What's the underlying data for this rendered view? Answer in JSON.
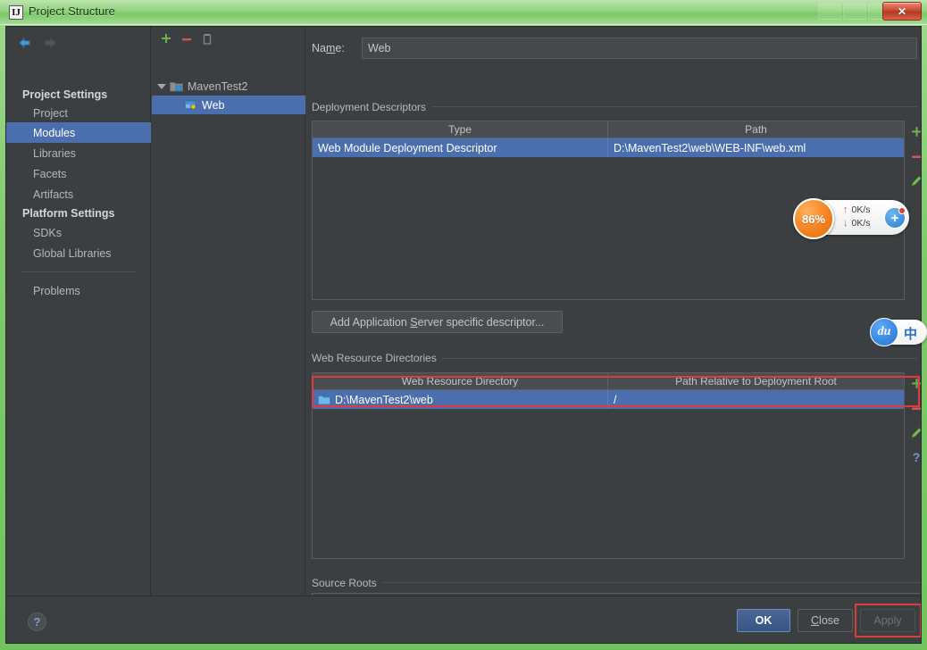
{
  "window": {
    "title": "Project Structure",
    "app_icon": "intellij-idea-icon",
    "close_label": "✕",
    "title_color": "#7fc96c"
  },
  "sidebar": {
    "nav": {
      "back_icon": "back-arrow-icon",
      "forward_icon": "forward-arrow-icon"
    },
    "groups": [
      {
        "label": "Project Settings",
        "items": [
          {
            "label": "Project",
            "selected": false
          },
          {
            "label": "Modules",
            "selected": true
          },
          {
            "label": "Libraries",
            "selected": false
          },
          {
            "label": "Facets",
            "selected": false
          },
          {
            "label": "Artifacts",
            "selected": false
          }
        ]
      },
      {
        "label": "Platform Settings",
        "items": [
          {
            "label": "SDKs",
            "selected": false
          },
          {
            "label": "Global Libraries",
            "selected": false
          }
        ]
      }
    ],
    "extra_item": {
      "label": "Problems",
      "selected": false
    },
    "selected_color": "#4b6eaf"
  },
  "tree": {
    "toolbar": [
      {
        "name": "add-module-button",
        "glyph": "+",
        "color": "#6ab04c"
      },
      {
        "name": "remove-module-button",
        "glyph": "−",
        "color": "#cc5555"
      },
      {
        "name": "copy-module-button",
        "glyph": "⧉",
        "color": "#8a8a8a"
      }
    ],
    "nodes": [
      {
        "label": "MavenTest2",
        "depth": 0,
        "expanded": true,
        "selected": false,
        "icon": "module-icon"
      },
      {
        "label": "Web",
        "depth": 1,
        "expanded": false,
        "selected": true,
        "icon": "web-facet-icon"
      }
    ]
  },
  "detail": {
    "name_field": {
      "label_pre": "Na",
      "label_mnemonic": "m",
      "label_post": "e:",
      "value": "Web",
      "placeholder": ""
    },
    "deployment_descriptors": {
      "title": "Deployment Descriptors",
      "columns": [
        "Type",
        "Path"
      ],
      "rows": [
        {
          "type": "Web Module Deployment Descriptor",
          "path": "D:\\MavenTest2\\web\\WEB-INF\\web.xml",
          "selected": true
        }
      ],
      "tools": [
        {
          "name": "add-descriptor-button",
          "glyph": "+",
          "color": "#6ab04c"
        },
        {
          "name": "remove-descriptor-button",
          "glyph": "−",
          "color": "#cc5555"
        },
        {
          "name": "edit-descriptor-button",
          "glyph": "✎",
          "color": "#7cc24f"
        }
      ]
    },
    "add_descriptor_button": {
      "pre": "Add Application ",
      "mnemonic": "S",
      "post": "erver specific descriptor..."
    },
    "web_resource_directories": {
      "title": "Web Resource Directories",
      "columns": [
        "Web Resource Directory",
        "Path Relative to Deployment Root"
      ],
      "rows": [
        {
          "directory": "D:\\MavenTest2\\web",
          "relative": "/",
          "selected": true
        }
      ],
      "tools": [
        {
          "name": "add-web-resource-button",
          "glyph": "+",
          "color": "#6ab04c"
        },
        {
          "name": "remove-web-resource-button",
          "glyph": "−",
          "color": "#cc5555"
        },
        {
          "name": "edit-web-resource-button",
          "glyph": "✎",
          "color": "#7cc24f"
        },
        {
          "name": "help-web-resource-button",
          "glyph": "?",
          "color": "#6f9ad1"
        }
      ],
      "highlight_color": "#e03a3a"
    },
    "source_roots": {
      "title": "Source Roots",
      "value": ""
    }
  },
  "bottom": {
    "help_icon": "?",
    "ok_label": "OK",
    "close_label_pre": "",
    "close_label_mnemonic": "C",
    "close_label_post": "lose",
    "apply_label": "Apply",
    "apply_highlight_color": "#e03a3a"
  },
  "overlays": {
    "speed_widget": {
      "cpu_percent": "86%",
      "upload_rate": "0K/s",
      "download_rate": "0K/s",
      "up_arrow": "↑",
      "down_arrow": "↓",
      "badge_glyph": "+",
      "accent": "#f58220"
    },
    "ime_widget": {
      "logo_text": "du",
      "mode_text": "中",
      "accent": "#2272d6"
    }
  }
}
